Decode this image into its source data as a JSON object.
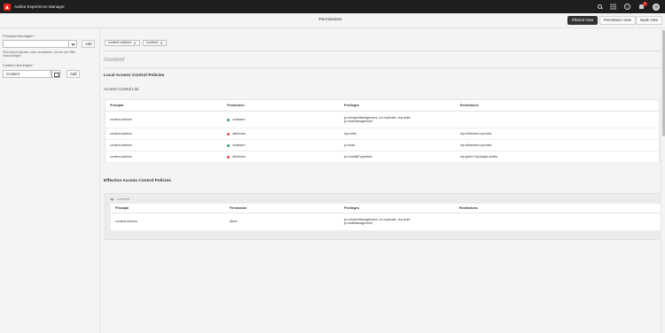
{
  "shell": {
    "product": "Adobe Experience Manager",
    "notification_count": "1"
  },
  "page": {
    "title": "Permissions"
  },
  "views": {
    "filtered": "Filtered View",
    "permission": "Permission View",
    "node": "Node View"
  },
  "rail": {
    "principal_label": "Principal hinzufügen *",
    "principal_value": "",
    "add_label": "Add",
    "help_text": "Principal (ergänzen oder auswählen, um ihn als Filter hinzuzufügen",
    "content_label": "Content hinzufügen *",
    "content_value": "/content",
    "add_content_label": "Add"
  },
  "chips": [
    "content-authors",
    "/content"
  ],
  "path": "/content",
  "local": {
    "heading": "Local Access Control Policies",
    "acl_heading": "Access Control List",
    "columns": [
      "Principal",
      "Permission",
      "Privileges",
      "Restrictions"
    ],
    "rows": [
      {
        "principal": "content-authors",
        "permission": "zulassen",
        "status_color": "#2d9d78",
        "privileges_1": "jcr:versionManagement, crx:replicate, rep:write,",
        "privileges_2": "jcr:lockManagement",
        "restrictions": ""
      },
      {
        "principal": "content-authors",
        "permission": "ablehnen",
        "status_color": "#e34850",
        "privileges_1": "rep:write",
        "privileges_2": "",
        "restrictions": "rep:ntNames=cq:meta"
      },
      {
        "principal": "content-authors",
        "permission": "zulassen",
        "status_color": "#2d9d78",
        "privileges_1": "jcr:read",
        "privileges_2": "",
        "restrictions": "rep:ntNames=cq:meta"
      },
      {
        "principal": "content-authors",
        "permission": "ablehnen",
        "status_color": "#e34850",
        "privileges_1": "jcr:modifyProperties",
        "privileges_2": "",
        "restrictions": "rep:glob=*/cq:target-amkts"
      }
    ]
  },
  "effective": {
    "heading": "Effective Access Control Policies",
    "group_path": "/content",
    "columns": [
      "Principal",
      "Permission",
      "Privileges",
      "Restrictions"
    ],
    "rows": [
      {
        "principal": "content-authors",
        "permission": "Allow",
        "privileges_1": "jcr:versionManagement, crx:replicate, rep:write,",
        "privileges_2": "jcr:lockManagement",
        "restrictions": ""
      }
    ]
  }
}
